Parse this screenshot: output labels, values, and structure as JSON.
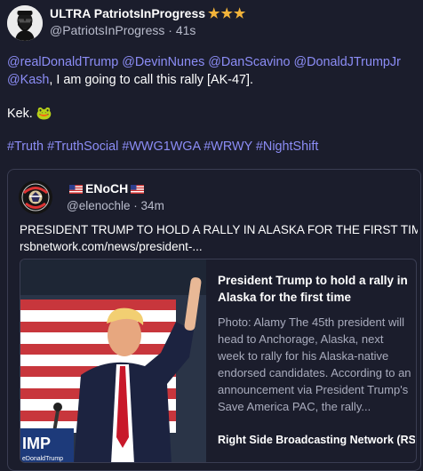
{
  "author": {
    "display_name": "ULTRA PatriotsInProgress",
    "stars": "★★★",
    "handle": "@PatriotsInProgress",
    "separator": "·",
    "time": "41s",
    "avatar_icon": "bearded-man-sunglasses-icon"
  },
  "post": {
    "mentions": [
      "@realDonaldTrump",
      "@DevinNunes",
      "@DanScavino",
      "@DonaldJTrumpJr",
      "@Kash"
    ],
    "text_after_mentions": ", I am going to call this rally [AK-47].",
    "line2_text": "Kek.",
    "line2_emoji": "🐸",
    "hashtags": [
      "#Truth",
      "#TruthSocial",
      "#WWG1WGA",
      "#WRWY",
      "#NightShift"
    ]
  },
  "quoted": {
    "display_name": "ENoCH",
    "flag_icon": "us-flag-icon",
    "handle": "@elenochle",
    "separator": "·",
    "time": "34m",
    "text": "PRESIDENT TRUMP TO HOLD A RALLY IN ALASKA FOR THE FIRST TIME",
    "link": "rsbnetwork.com/news/president-...",
    "avatar_icon": "american-revolution-logo-icon",
    "card": {
      "title": "President Trump to hold a rally in Alaska for the first time",
      "description": "Photo: Alamy The 45th president will head to Anchorage, Alaska, next week to rally for his Alaska-native endorsed candidates. According to an announcement via President Trump's Save America PAC, the rally...",
      "source": "Right Side Broadcasting Network (RS",
      "image_alt": "Trump waving at rally with US flag background",
      "podium_text": "IMP",
      "podium_subtext": "eDonaldTrump"
    }
  },
  "colors": {
    "background": "#1b1d2c",
    "link": "#8c8df6",
    "muted": "#b9bccc",
    "border": "#3a3d52",
    "star": "#f2b33a"
  }
}
